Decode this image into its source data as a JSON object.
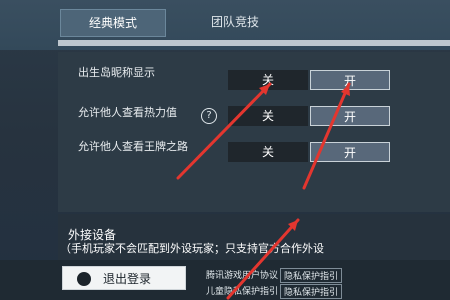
{
  "tabs": [
    {
      "label": "经典模式",
      "active": true
    },
    {
      "label": "团队竞技",
      "active": false
    }
  ],
  "settings": [
    {
      "label": "出生岛昵称显示",
      "off_label": "关",
      "on_label": "开",
      "selected": "on",
      "info_icon": false
    },
    {
      "label": "允许他人查看热力值",
      "off_label": "关",
      "on_label": "开",
      "selected": "on",
      "info_icon": true,
      "info_glyph": "?"
    },
    {
      "label": "允许他人查看王牌之路",
      "off_label": "关",
      "on_label": "开",
      "selected": "on",
      "info_icon": false
    }
  ],
  "external": {
    "title": "外接设备",
    "description": "（手机玩家不会匹配到外设玩家；只支持官方合作外设"
  },
  "bottom": {
    "logout_label": "退出登录",
    "links": [
      "腾讯游戏用户协议",
      "隐私保护指引",
      "儿童隐私保护指引",
      "隐私保护指引"
    ]
  },
  "colors": {
    "accent_red": "#e3362f",
    "button_on_bg": "#58687a",
    "button_off_bg": "#1f262c"
  }
}
